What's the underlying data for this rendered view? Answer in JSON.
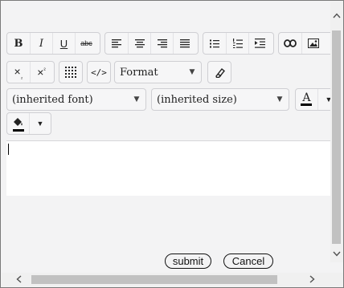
{
  "toolbar": {
    "bold": "B",
    "italic": "I",
    "underline": "U",
    "strikethrough": "abc",
    "format_select": "Format",
    "font_select": "(inherited font)",
    "size_select": "(inherited size)",
    "font_color_letter": "A"
  },
  "icons": [
    "bold-icon",
    "italic-icon",
    "underline-icon",
    "strikethrough-icon",
    "align-left-icon",
    "align-center-icon",
    "align-right-icon",
    "justify-icon",
    "bulleted-list-icon",
    "numbered-list-icon",
    "indent-icon",
    "link-icon",
    "image-icon",
    "subscript-icon",
    "superscript-icon",
    "table-icon",
    "source-code-icon",
    "eraser-icon",
    "font-color-icon",
    "background-color-icon"
  ],
  "colors": {
    "font_color": "#000000",
    "background_color": "#000000"
  },
  "buttons": {
    "submit": "submit",
    "cancel": "Cancel"
  }
}
